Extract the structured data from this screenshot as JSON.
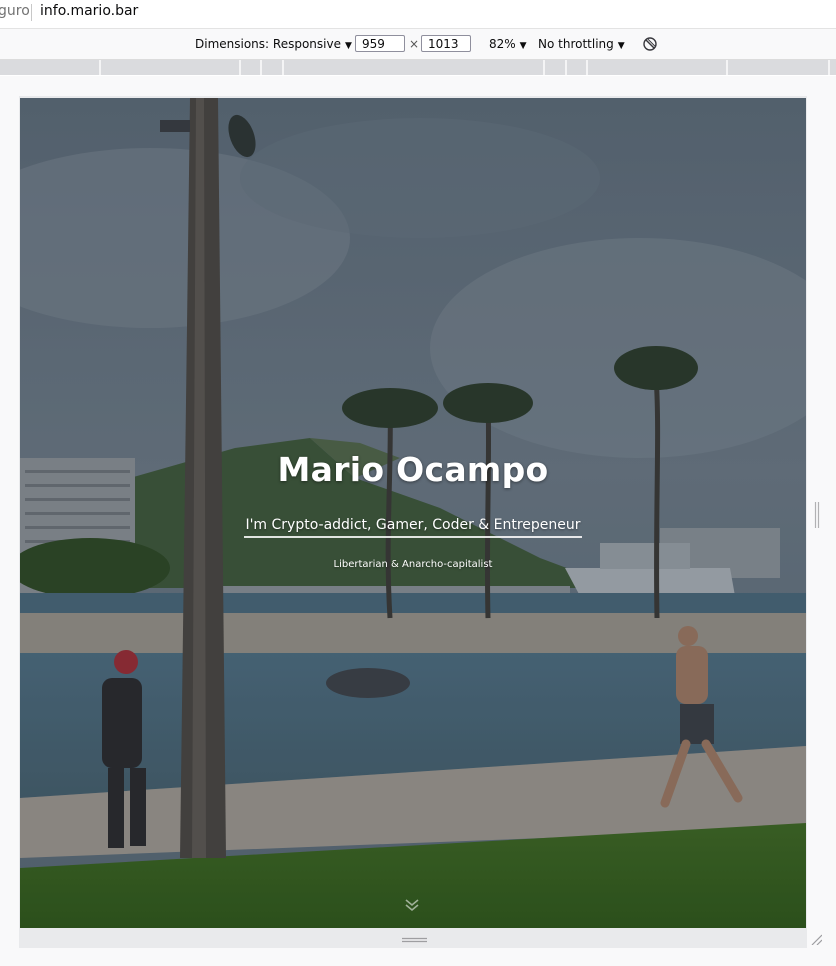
{
  "urlbar": {
    "security_text": "guro",
    "url": "info.mario.bar"
  },
  "toolbar": {
    "dimensions_label": "Dimensions: Responsive",
    "width_value": "959",
    "times_symbol": "×",
    "height_value": "1013",
    "zoom_label": "82%",
    "throttling_label": "No throttling",
    "rotate_icon": "rotate-icon",
    "caret_icon": "chevron-down-icon"
  },
  "page": {
    "title": "Mario Ocampo",
    "subtitle": "I'm Crypto-addict, Gamer, Coder & Entrepeneur",
    "tagline": "Libertarian & Anarcho-capitalist",
    "scroll_icon": "double-chevron-down-icon"
  },
  "colors": {
    "toolbar_bg": "#f9f9fa",
    "ruler_bg": "#dadbde",
    "hero_text": "#ffffff"
  }
}
